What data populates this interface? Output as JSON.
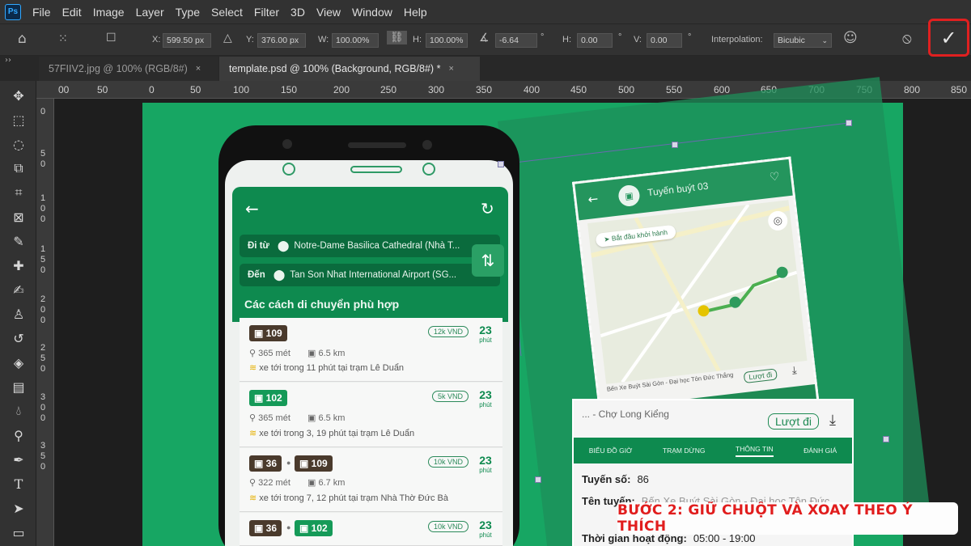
{
  "menubar": {
    "logo": "Ps",
    "items": [
      "File",
      "Edit",
      "Image",
      "Layer",
      "Type",
      "Select",
      "Filter",
      "3D",
      "View",
      "Window",
      "Help"
    ]
  },
  "options": {
    "x_label": "X:",
    "x_value": "599.50 px",
    "y_label": "Y:",
    "y_value": "376.00 px",
    "w_label": "W:",
    "w_value": "100.00%",
    "h_label": "H:",
    "h_value": "100.00%",
    "angle_value": "-6.64",
    "hskew_label": "H:",
    "hskew_value": "0.00",
    "vskew_label": "V:",
    "vskew_value": "0.00",
    "degree_symbol": "°",
    "interpolation_label": "Interpolation:",
    "interpolation_value": "Bicubic",
    "commit_symbol": "✓",
    "cancel_symbol": "⦸"
  },
  "tabs": [
    {
      "label": "57FIIV2.jpg @ 100% (RGB/8#)",
      "close": "×"
    },
    {
      "label": "template.psd @ 100% (Background, RGB/8#) *",
      "close": "×"
    }
  ],
  "ruler_top": [
    "00",
    "50",
    "0",
    "50",
    "100",
    "150",
    "200",
    "250",
    "300",
    "350",
    "400",
    "450",
    "500",
    "550",
    "600",
    "650",
    "700",
    "750",
    "800",
    "850"
  ],
  "ruler_left": [
    "0",
    "5",
    "0",
    "1",
    "0",
    "0",
    "1",
    "5",
    "0",
    "2",
    "0",
    "0",
    "2",
    "5",
    "0",
    "3",
    "0",
    "0",
    "3",
    "5",
    "0"
  ],
  "app": {
    "from_label": "Đi từ",
    "from_value": "Notre-Dame Basilica Cathedral (Nhà T...",
    "to_label": "Đến",
    "to_value": "Tan Son Nhat International Airport (SG...",
    "section_title": "Các cách di chuyển phù hợp",
    "routes": [
      {
        "buses": [
          "109"
        ],
        "price": "12k VND",
        "minutes": "23",
        "unit": "phút",
        "walk": "365 mét",
        "ride": "6.5 km",
        "eta": "xe tới trong 11 phút tại trạm Lê Duẩn"
      },
      {
        "buses": [
          "102"
        ],
        "price": "5k VND",
        "minutes": "23",
        "unit": "phút",
        "walk": "365 mét",
        "ride": "6.5 km",
        "eta": "xe tới trong 3, 19 phút tại trạm Lê Duẩn"
      },
      {
        "buses": [
          "36",
          "109"
        ],
        "price": "10k VND",
        "minutes": "23",
        "unit": "phút",
        "walk": "322 mét",
        "ride": "6.7 km",
        "eta": "xe tới trong 7, 12 phút tại trạm Nhà Thờ Đức Bà"
      },
      {
        "buses": [
          "36",
          "102"
        ],
        "price": "10k VND",
        "minutes": "23",
        "unit": "phút",
        "walk": "",
        "ride": "",
        "eta": ""
      }
    ]
  },
  "layer": {
    "header_title": "Tuyến buýt 03",
    "start_button": "Bắt đầu khởi hành",
    "route_text": "Bến Xe Buýt Sài Gòn - Đại học Tôn Đức Thắng",
    "luot_di_small": "Lượt đi",
    "subtitle": "... - Chợ Long Kiểng",
    "luot_di": "Lượt đi",
    "tabs": [
      "BIỂU ĐỒ GIỜ",
      "TRẠM DỪNG",
      "THÔNG TIN",
      "ĐÁNH GIÁ"
    ],
    "route_no_label": "Tuyến số:",
    "route_no": "86",
    "route_name_label": "Tên tuyến:",
    "route_name": "Bến Xe Buýt Sài Gòn - Đại học Tôn Đức",
    "hours_label": "Thời gian hoạt động:",
    "hours": "05:00 - 19:00"
  },
  "caption": "BƯỚC 2: GIỮ CHUỘT VÀ XOAY THEO Ý THÍCH",
  "colors": {
    "canvas": "#17a663",
    "app_green": "#0e8a4f",
    "caption_red": "#e11d1d",
    "highlight_red": "#e02020"
  }
}
